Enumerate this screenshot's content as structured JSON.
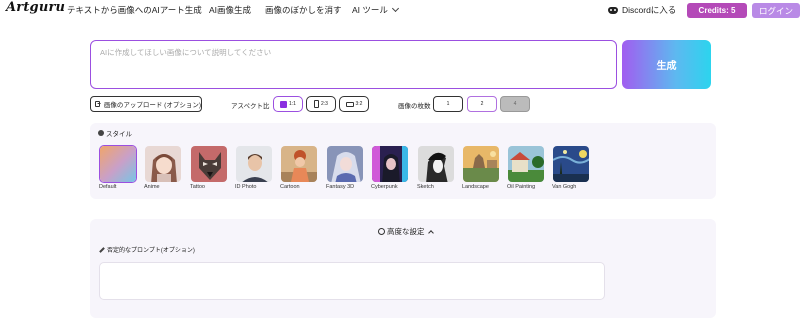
{
  "header": {
    "logo": "Artguru",
    "nav": [
      "テキストから画像へのAIアート生成",
      "AI画像生成",
      "画像のぼかしを消す",
      "AI ツール"
    ],
    "discord": "Discordに入る",
    "credits": "Credits: 5",
    "login": "ログイン"
  },
  "prompt": {
    "placeholder": "AIに作成してほしい画像について説明してください",
    "value": "",
    "generate_label": "生成"
  },
  "options": {
    "upload_label": "画像のアップロード (オプション)",
    "aspect_label": "アスペクト比",
    "aspect_ratios": [
      "1:1",
      "2:3",
      "3:2"
    ],
    "aspect_selected": "1:1",
    "count_label": "画像の枚数",
    "counts": [
      "1",
      "2",
      "4"
    ],
    "count_selected": "2"
  },
  "styles": {
    "title": "スタイル",
    "selected": "Default",
    "items": [
      {
        "label": "Default"
      },
      {
        "label": "Anime"
      },
      {
        "label": "Tattoo"
      },
      {
        "label": "ID Photo"
      },
      {
        "label": "Cartoon"
      },
      {
        "label": "Fantasy 3D"
      },
      {
        "label": "Cyberpunk"
      },
      {
        "label": "Sketch"
      },
      {
        "label": "Landscape"
      },
      {
        "label": "Oil Painting"
      },
      {
        "label": "Van Gogh"
      }
    ]
  },
  "advanced": {
    "title": "高度な設定",
    "negative_label": "否定的なプロンプト(オプション)",
    "negative_value": ""
  },
  "colors": {
    "accent": "#9b4fe0",
    "credits_bg": "#b44ab8",
    "login_bg": "#b98ae6",
    "generate_gradient": [
      "#a15df0",
      "#2cd4ee"
    ]
  }
}
